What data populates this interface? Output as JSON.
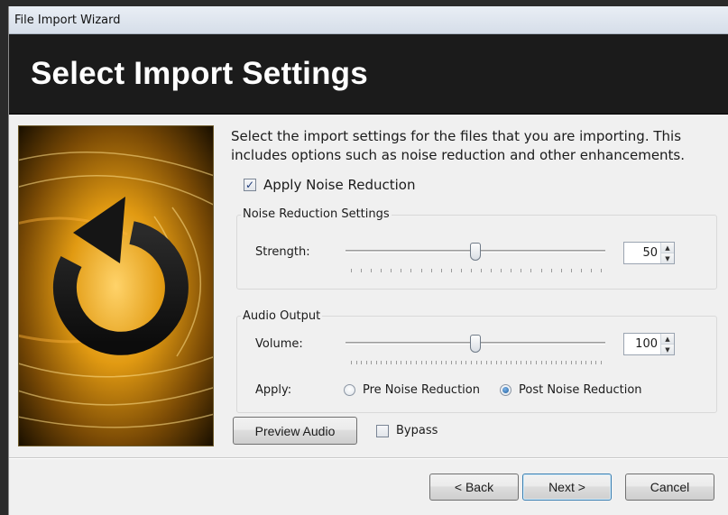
{
  "window": {
    "title": "File Import Wizard"
  },
  "header": {
    "title": "Select Import Settings"
  },
  "description": "Select the import settings for the files that you are importing. This includes options such as noise reduction and other enhancements.",
  "apply_noise_reduction": {
    "label": "Apply Noise Reduction",
    "checked": true
  },
  "noise_group": {
    "title": "Noise Reduction Settings",
    "strength_label": "Strength:",
    "strength_value": "50",
    "strength_fraction": 0.5
  },
  "audio_group": {
    "title": "Audio Output",
    "volume_label": "Volume:",
    "volume_value": "100",
    "volume_fraction": 0.5,
    "apply_label": "Apply:",
    "radio_pre": {
      "label": "Pre Noise Reduction",
      "selected": false
    },
    "radio_post": {
      "label": "Post Noise Reduction",
      "selected": true
    }
  },
  "preview_button": "Preview Audio",
  "bypass": {
    "label": "Bypass",
    "checked": false
  },
  "footer": {
    "back": "< Back",
    "next": "Next >",
    "cancel": "Cancel"
  },
  "icons": {
    "check": "check-icon",
    "spin_up": "triangle-up-icon",
    "spin_down": "triangle-down-icon",
    "art": "refresh-arrow-icon"
  },
  "colors": {
    "banner": "#1b1b1b",
    "accent": "#d4a017",
    "background": "#f0f0f0"
  }
}
